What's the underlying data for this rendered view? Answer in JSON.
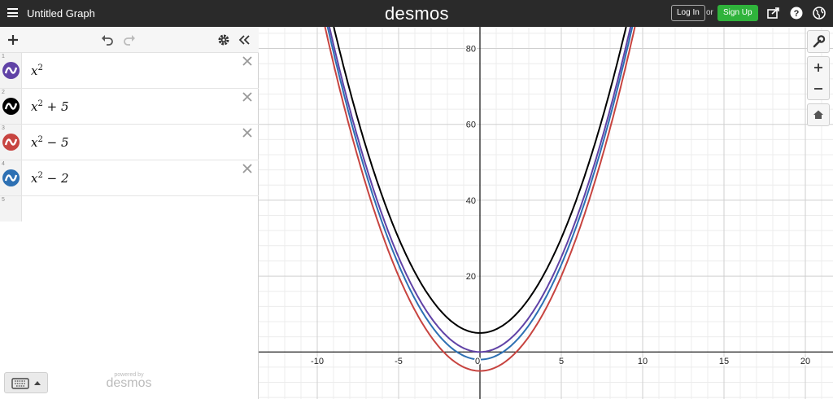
{
  "app": {
    "title": "Untitled Graph",
    "logo": "desmos",
    "login_label": "Log In",
    "or_label": "or",
    "signup_label": "Sign Up",
    "signup_color": "#2fb33b"
  },
  "panel": {
    "icons": [
      "plus-icon",
      "undo-icon",
      "redo-icon",
      "gear-icon",
      "collapse-icon"
    ],
    "expressions": [
      {
        "num": "1",
        "base": "x",
        "exp": "2",
        "tail": "",
        "color": "#6042a6",
        "icon": "wave-icon"
      },
      {
        "num": "2",
        "base": "x",
        "exp": "2",
        "tail": " + 5",
        "color": "#000000",
        "icon": "wave-icon"
      },
      {
        "num": "3",
        "base": "x",
        "exp": "2",
        "tail": " − 5",
        "color": "#c74440",
        "icon": "wave-icon"
      },
      {
        "num": "4",
        "base": "x",
        "exp": "2",
        "tail": " − 2",
        "color": "#2d70b3",
        "icon": "wave-icon"
      }
    ],
    "empty_row_num": "5",
    "powered_by": "powered by",
    "powered_logo": "desmos"
  },
  "graph": {
    "x_ticks": [
      "-10",
      "-5",
      "0",
      "5",
      "10",
      "15",
      "20"
    ],
    "y_ticks": [
      "20",
      "40",
      "60",
      "80"
    ],
    "x_tick_values": [
      -10,
      -5,
      0,
      5,
      10,
      15,
      20
    ],
    "y_tick_values": [
      20,
      40,
      60,
      80
    ],
    "xlim": [
      -13.6,
      21.7
    ],
    "ylim": [
      -12.4,
      85.7
    ],
    "grid": true,
    "curves": [
      {
        "expr": "x^2",
        "shift": 0,
        "color": "#6042a6"
      },
      {
        "expr": "x^2+5",
        "shift": 5,
        "color": "#000000"
      },
      {
        "expr": "x^2-5",
        "shift": -5,
        "color": "#c74440"
      },
      {
        "expr": "x^2-2",
        "shift": -2,
        "color": "#2d70b3"
      }
    ]
  },
  "zoom": {
    "icons": [
      "wrench-icon",
      "zoom-in-icon",
      "zoom-out-icon",
      "home-icon"
    ]
  }
}
